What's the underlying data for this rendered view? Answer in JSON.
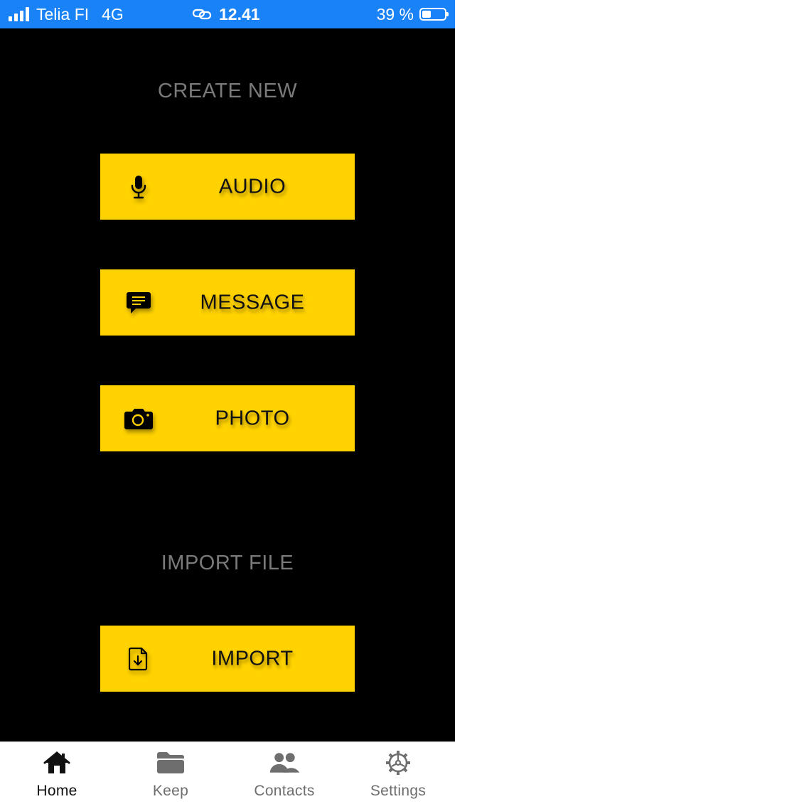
{
  "status_bar": {
    "carrier": "Telia FI",
    "network": "4G",
    "time": "12.41",
    "battery": "39 %",
    "battery_level": 0.39
  },
  "create_section": {
    "title": "CREATE NEW",
    "buttons": [
      {
        "label": "AUDIO",
        "icon": "microphone-icon"
      },
      {
        "label": "MESSAGE",
        "icon": "message-icon"
      },
      {
        "label": "PHOTO",
        "icon": "camera-icon"
      }
    ]
  },
  "import_section": {
    "title": "IMPORT FILE",
    "button": {
      "label": "IMPORT",
      "icon": "file-import-icon"
    }
  },
  "tab_bar": {
    "active": "Home",
    "tabs": [
      {
        "label": "Home",
        "icon": "home-icon"
      },
      {
        "label": "Keep",
        "icon": "folder-icon"
      },
      {
        "label": "Contacts",
        "icon": "contacts-icon"
      },
      {
        "label": "Settings",
        "icon": "gear-icon"
      }
    ]
  },
  "colors": {
    "status_bar": "#1a82f7",
    "background": "#000000",
    "button": "#ffd200",
    "section_title": "#7a7a7a",
    "tab_active": "#111111",
    "tab_inactive": "#6e6e6e"
  }
}
